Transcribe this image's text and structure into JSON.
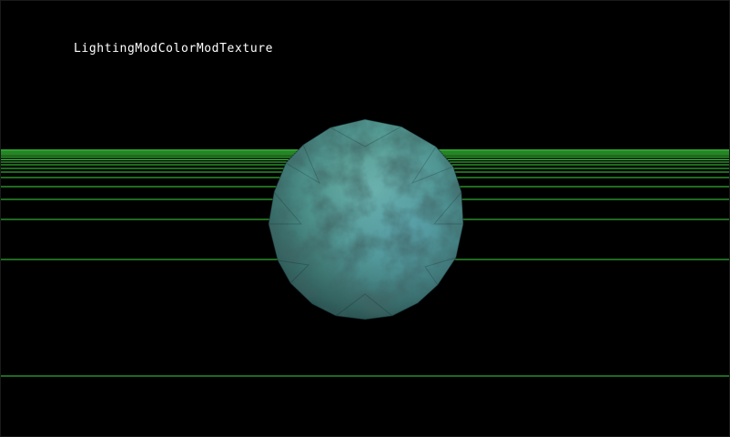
{
  "scene": {
    "mode_label": "LightingModColorModTexture",
    "background_color": "#000000",
    "grid_line_color": "#3ed43e",
    "sphere": {
      "texture": "mottled-stone",
      "highlight_color": "#6fb4a8",
      "base_color": "#3f7a76",
      "shadow_color": "#1c3b3e"
    }
  }
}
